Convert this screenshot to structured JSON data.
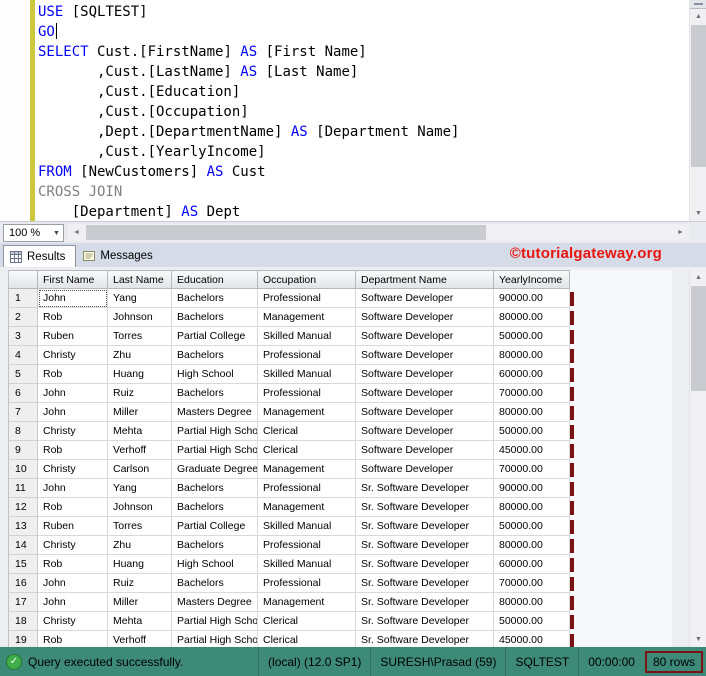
{
  "editor": {
    "zoom_label": "100 %",
    "lines": [
      {
        "segments": [
          {
            "text": "USE",
            "color": "keyword"
          },
          {
            "text": " [SQLTEST]",
            "color": "default"
          }
        ]
      },
      {
        "segments": [
          {
            "text": "GO",
            "color": "keyword"
          }
        ],
        "cursor": true
      },
      {
        "segments": [
          {
            "text": "SELECT",
            "color": "keyword"
          },
          {
            "text": " Cust.[FirstName] ",
            "color": "default"
          },
          {
            "text": "AS",
            "color": "keyword"
          },
          {
            "text": " [First Name]",
            "color": "default"
          }
        ]
      },
      {
        "segments": [
          {
            "text": "       ,Cust.[LastName] ",
            "color": "default"
          },
          {
            "text": "AS",
            "color": "keyword"
          },
          {
            "text": " [Last Name]",
            "color": "default"
          }
        ]
      },
      {
        "segments": [
          {
            "text": "       ,Cust.[Education]",
            "color": "default"
          }
        ]
      },
      {
        "segments": [
          {
            "text": "       ,Cust.[Occupation]",
            "color": "default"
          }
        ]
      },
      {
        "segments": [
          {
            "text": "       ,Dept.[DepartmentName] ",
            "color": "default"
          },
          {
            "text": "AS",
            "color": "keyword"
          },
          {
            "text": " [Department Name]",
            "color": "default"
          }
        ]
      },
      {
        "segments": [
          {
            "text": "       ,Cust.[YearlyIncome]",
            "color": "default"
          }
        ]
      },
      {
        "segments": [
          {
            "text": "FROM",
            "color": "keyword"
          },
          {
            "text": " [NewCustomers] ",
            "color": "default"
          },
          {
            "text": "AS",
            "color": "keyword"
          },
          {
            "text": " Cust",
            "color": "default"
          }
        ]
      },
      {
        "segments": [
          {
            "text": "CROSS JOIN",
            "color": "operator"
          }
        ]
      },
      {
        "segments": [
          {
            "text": "    [Department] ",
            "color": "default"
          },
          {
            "text": "AS",
            "color": "keyword"
          },
          {
            "text": " Dept",
            "color": "default"
          }
        ]
      }
    ]
  },
  "watermark": "©tutorialgateway.org",
  "results_pane": {
    "tabs": [
      {
        "label": "Results",
        "active": true
      },
      {
        "label": "Messages",
        "active": false
      }
    ]
  },
  "grid": {
    "columns": [
      "First Name",
      "Last Name",
      "Education",
      "Occupation",
      "Department Name",
      "YearlyIncome"
    ],
    "rows": [
      [
        "John",
        "Yang",
        "Bachelors",
        "Professional",
        "Software Developer",
        "90000.00"
      ],
      [
        "Rob",
        "Johnson",
        "Bachelors",
        "Management",
        "Software Developer",
        "80000.00"
      ],
      [
        "Ruben",
        "Torres",
        "Partial College",
        "Skilled Manual",
        "Software Developer",
        "50000.00"
      ],
      [
        "Christy",
        "Zhu",
        "Bachelors",
        "Professional",
        "Software Developer",
        "80000.00"
      ],
      [
        "Rob",
        "Huang",
        "High School",
        "Skilled Manual",
        "Software Developer",
        "60000.00"
      ],
      [
        "John",
        "Ruiz",
        "Bachelors",
        "Professional",
        "Software Developer",
        "70000.00"
      ],
      [
        "John",
        "Miller",
        "Masters Degree",
        "Management",
        "Software Developer",
        "80000.00"
      ],
      [
        "Christy",
        "Mehta",
        "Partial High School",
        "Clerical",
        "Software Developer",
        "50000.00"
      ],
      [
        "Rob",
        "Verhoff",
        "Partial High School",
        "Clerical",
        "Software Developer",
        "45000.00"
      ],
      [
        "Christy",
        "Carlson",
        "Graduate Degree",
        "Management",
        "Software Developer",
        "70000.00"
      ],
      [
        "John",
        "Yang",
        "Bachelors",
        "Professional",
        "Sr. Software Developer",
        "90000.00"
      ],
      [
        "Rob",
        "Johnson",
        "Bachelors",
        "Management",
        "Sr. Software Developer",
        "80000.00"
      ],
      [
        "Ruben",
        "Torres",
        "Partial College",
        "Skilled Manual",
        "Sr. Software Developer",
        "50000.00"
      ],
      [
        "Christy",
        "Zhu",
        "Bachelors",
        "Professional",
        "Sr. Software Developer",
        "80000.00"
      ],
      [
        "Rob",
        "Huang",
        "High School",
        "Skilled Manual",
        "Sr. Software Developer",
        "60000.00"
      ],
      [
        "John",
        "Ruiz",
        "Bachelors",
        "Professional",
        "Sr. Software Developer",
        "70000.00"
      ],
      [
        "John",
        "Miller",
        "Masters Degree",
        "Management",
        "Sr. Software Developer",
        "80000.00"
      ],
      [
        "Christy",
        "Mehta",
        "Partial High School",
        "Clerical",
        "Sr. Software Developer",
        "50000.00"
      ],
      [
        "Rob",
        "Verhoff",
        "Partial High School",
        "Clerical",
        "Sr. Software Developer",
        "45000.00"
      ]
    ]
  },
  "status_bar": {
    "message": "Query executed successfully.",
    "items": [
      "(local) (12.0 SP1)",
      "SURESH\\Prasad (59)",
      "SQLTEST",
      "00:00:00"
    ],
    "row_count": "80 rows"
  },
  "colors": {
    "keyword_blue": "#0000ff",
    "operator_gray": "#808080",
    "track_changes_yellow": "#cdc73c",
    "watermark_red": "#e8150f",
    "status_bar_teal": "#3d8a78",
    "highlight_maroon": "#7b1214",
    "success_green": "#3fae49"
  }
}
